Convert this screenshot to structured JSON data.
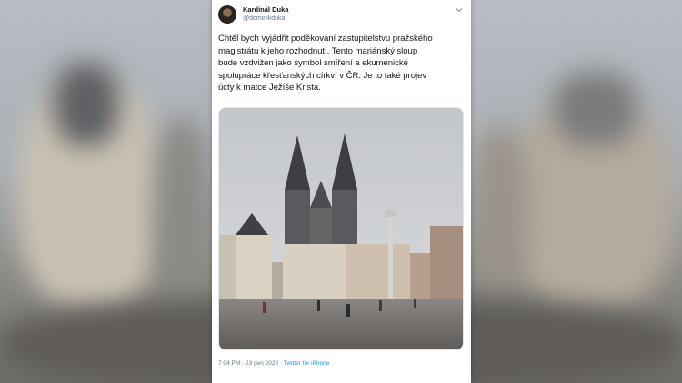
{
  "tweet": {
    "display_name": "Kardinál Duka",
    "handle": "@dominikduka",
    "text": "Chtěl bych vyjádřit poděkování zastupitelstvu pražského\nmagistrátu k jeho rozhodnutí. Tento mariánský sloup\nbude vzdvižen jako symbol smíření a ekumenické\nspolupráce křesťanských církví v ČR. Je to také projev\núcty k matce Ježíše Krista.",
    "time": "7:04 PM · 23 gen 2020 · ",
    "source": "Twitter for iPhone",
    "menu_icon": "chevron-down-icon"
  },
  "colors": {
    "text": "#14171a",
    "secondary": "#657786",
    "link": "#1b95e0"
  }
}
